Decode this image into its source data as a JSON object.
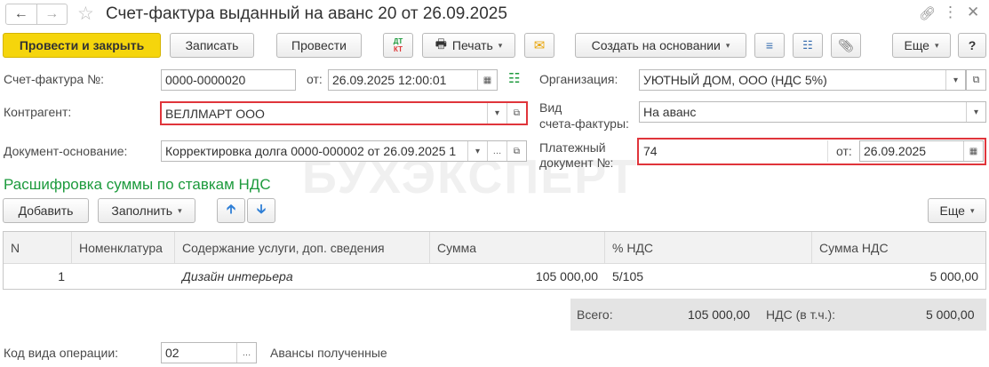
{
  "title": "Счет-фактура выданный на аванс 20 от 26.09.2025",
  "toolbar": {
    "post_close": "Провести и закрыть",
    "save": "Записать",
    "post": "Провести",
    "dtkt": "ДТ КТ",
    "print": "Печать",
    "create_based": "Создать на основании",
    "more": "Еще",
    "help": "?"
  },
  "form": {
    "invoice_no_label": "Счет-фактура №:",
    "invoice_no": "0000-0000020",
    "from_label": "от:",
    "date": "26.09.2025 12:00:01",
    "org_label": "Организация:",
    "org": "УЮТНЫЙ ДОМ, ООО (НДС 5%)",
    "counterparty_label": "Контрагент:",
    "counterparty": "ВЕЛЛМАРТ ООО",
    "kind_label_1": "Вид",
    "kind_label_2": "счета-фактуры:",
    "kind": "На аванс",
    "base_doc_label": "Документ-основание:",
    "base_doc": "Корректировка долга 0000-000002 от 26.09.2025 1",
    "payment_label_1": "Платежный",
    "payment_label_2": "документ №:",
    "payment_no": "74",
    "payment_from_label": "от:",
    "payment_date": "26.09.2025"
  },
  "section_title": "Расшифровка суммы по ставкам НДС",
  "table_toolbar": {
    "add": "Добавить",
    "fill": "Заполнить",
    "more": "Еще"
  },
  "table": {
    "headers": [
      "N",
      "Номенклатура",
      "Содержание услуги, доп. сведения",
      "Сумма",
      "% НДС",
      "Сумма НДС"
    ],
    "rows": [
      {
        "n": "1",
        "item": "",
        "content": "Дизайн интерьера",
        "sum": "105 000,00",
        "vat_rate": "5/105",
        "vat_sum": "5 000,00"
      }
    ]
  },
  "totals": {
    "total_label": "Всего:",
    "total": "105 000,00",
    "vat_label": "НДС (в т.ч.):",
    "vat": "5 000,00"
  },
  "operation": {
    "label": "Код вида операции:",
    "code": "02",
    "name": "Авансы полученные"
  },
  "watermark": "БУХЭКСПЕРТ",
  "colors": {
    "accent_yellow": "#f5d50c",
    "section_green": "#1c9a3c",
    "highlight_red": "#e0353b"
  }
}
